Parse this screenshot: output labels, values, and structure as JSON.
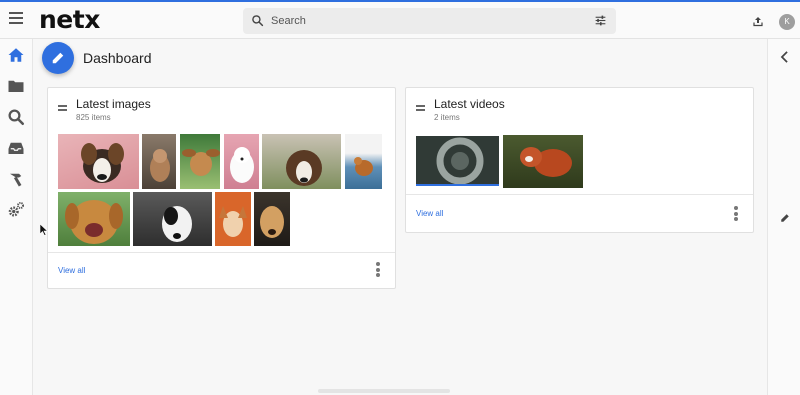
{
  "app": {
    "logo": "netx",
    "avatar_initial": "K"
  },
  "search": {
    "placeholder": "Search"
  },
  "page": {
    "title": "Dashboard"
  },
  "icons": {
    "menu": "hamburger-icon",
    "search": "search-icon",
    "filter": "sliders-icon",
    "upload": "upload-icon",
    "home": "home-icon",
    "folder": "folder-icon",
    "nav_search": "search-icon",
    "inbox": "inbox-icon",
    "tools": "hammer-icon",
    "settings": "gears-icon",
    "collapse": "chevron-left-icon",
    "edit": "pencil-icon"
  },
  "colors": {
    "accent": "#2f6fdf",
    "nav_active": "#2f6fdf",
    "nav_inactive": "#555555"
  },
  "cards": {
    "images": {
      "title": "Latest images",
      "subtitle": "825 items",
      "view_all": "View all"
    },
    "videos": {
      "title": "Latest videos",
      "subtitle": "2 items",
      "view_all": "View all"
    }
  },
  "images": [
    {
      "name": "dog-beagle-pink"
    },
    {
      "name": "dog-sitting-street"
    },
    {
      "name": "dog-ears-flying"
    },
    {
      "name": "dog-samoyed-pink"
    },
    {
      "name": "dog-collie-field"
    },
    {
      "name": "dog-running-beach"
    },
    {
      "name": "dog-golden-closeup"
    },
    {
      "name": "dog-black-white"
    },
    {
      "name": "dog-corgi-orange"
    },
    {
      "name": "dog-golden-dark"
    }
  ],
  "videos": [
    {
      "name": "video-tire-wheel"
    },
    {
      "name": "video-red-panda"
    }
  ]
}
